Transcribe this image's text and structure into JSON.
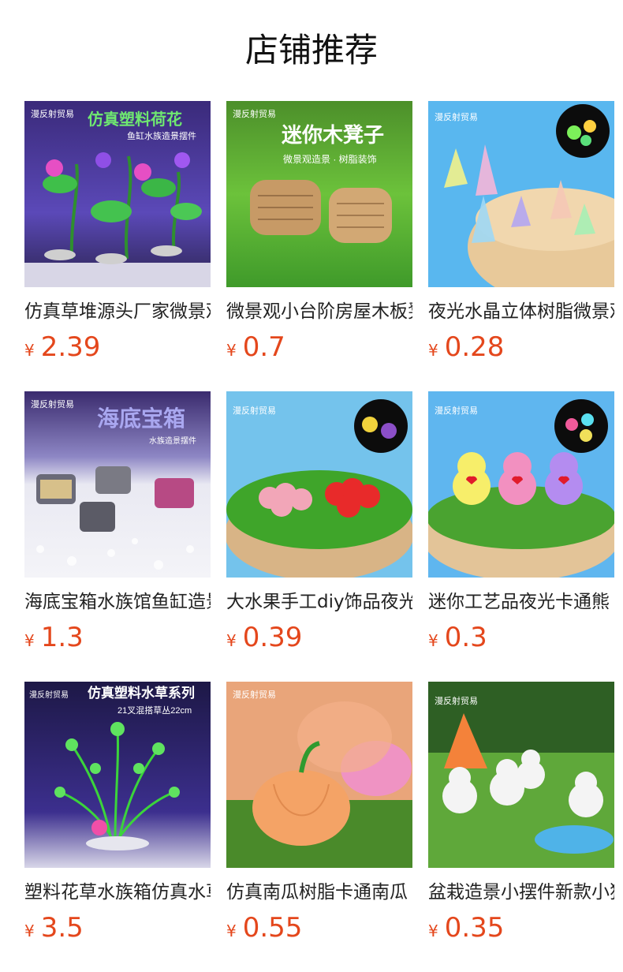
{
  "page_title": "店铺推荐",
  "currency_symbol": "¥",
  "products": [
    {
      "title": "仿真草堆源头厂家微景观",
      "price": "2.39",
      "image": "plastic-lotus-aquarium-image",
      "banner": "仿真塑料荷花",
      "sub": "鱼缸水族造景摆件",
      "brand": "漫反射贸易"
    },
    {
      "title": "微景观小台阶房屋木板凳",
      "price": "0.7",
      "image": "mini-wood-stool-image",
      "banner": "迷你木凳子",
      "sub": "微景观造景 · 树脂装饰",
      "brand": "漫反射贸易"
    },
    {
      "title": "夜光水晶立体树脂微景观",
      "price": "0.28",
      "image": "glow-crystal-image",
      "banner": "",
      "sub": "",
      "brand": "漫反射贸易"
    },
    {
      "title": "海底宝箱水族馆鱼缸造景",
      "price": "1.3",
      "image": "treasure-chest-image",
      "banner": "海底宝箱",
      "sub": "水族造景摆件",
      "brand": "漫反射贸易"
    },
    {
      "title": "大水果手工diy饰品夜光",
      "price": "0.39",
      "image": "glow-grapes-image",
      "banner": "",
      "sub": "",
      "brand": "漫反射贸易"
    },
    {
      "title": "迷你工艺品夜光卡通熊",
      "price": "0.3",
      "image": "glow-bears-image",
      "banner": "",
      "sub": "",
      "brand": "漫反射贸易"
    },
    {
      "title": "塑料花草水族箱仿真水草",
      "price": "3.5",
      "image": "plastic-waterweed-image",
      "banner": "仿真塑料水草系列",
      "sub": "21叉混搭草丛22cm",
      "brand": "漫反射贸易"
    },
    {
      "title": "仿真南瓜树脂卡通南瓜",
      "price": "0.55",
      "image": "resin-pumpkin-image",
      "banner": "",
      "sub": "",
      "brand": "漫反射贸易"
    },
    {
      "title": "盆栽造景小摆件新款小狗",
      "price": "0.35",
      "image": "white-puppies-image",
      "banner": "",
      "sub": "",
      "brand": "漫反射贸易"
    }
  ]
}
